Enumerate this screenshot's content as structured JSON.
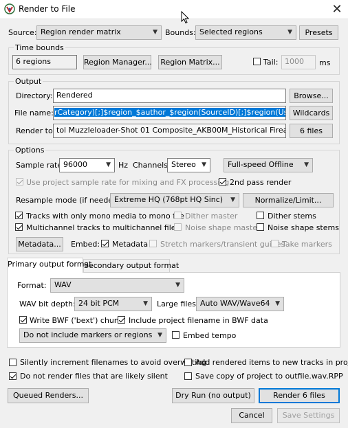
{
  "window": {
    "title": "Render to File"
  },
  "source": {
    "label": "Source:",
    "value": "Region render matrix"
  },
  "bounds": {
    "label": "Bounds:",
    "value": "Selected regions"
  },
  "presets_label": "Presets",
  "time_bounds": {
    "title": "Time bounds",
    "regions_value": "6 regions",
    "region_manager": "Region Manager...",
    "region_matrix": "Region Matrix...",
    "tail_label": "Tail:",
    "tail_checked": false,
    "tail_value": "1000",
    "tail_unit": "ms"
  },
  "output": {
    "title": "Output",
    "directory_label": "Directory:",
    "directory_value": "Rendered",
    "browse": "Browse...",
    "filename_label": "File name:",
    "filename_value": "rCategory)[;]$region_$author_$region(SourceID)[;]$region(UserData)[;]",
    "wildcards": "Wildcards",
    "render_to_label": "Render to:",
    "render_to_value": "tol Muzzleloader-Shot 01 Composite_AKB00M_Historical Firearms.wav",
    "files_count": "6 files"
  },
  "options": {
    "title": "Options",
    "sample_rate_label": "Sample rate:",
    "sample_rate_value": "96000",
    "hz": "Hz",
    "channels_label": "Channels:",
    "channels_value": "Stereo",
    "mode_value": "Full-speed Offline",
    "use_project_rate": "Use project sample rate for mixing and FX processing",
    "second_pass": "2nd pass render",
    "resample_label": "Resample mode (if needed):",
    "resample_value": "Extreme HQ (768pt HQ Sinc)",
    "normalize": "Normalize/Limit...",
    "tracks_mono": "Tracks with only mono media to mono file",
    "dither_master": "Dither master",
    "dither_stems": "Dither stems",
    "multichannel": "Multichannel tracks to multichannel files",
    "noise_master": "Noise shape master",
    "noise_stems": "Noise shape stems",
    "metadata_btn": "Metadata...",
    "embed_label": "Embed:",
    "embed_metadata": "Metadata",
    "stretch_markers": "Stretch markers/transient guides",
    "take_markers": "Take markers"
  },
  "tabs": {
    "primary": "Primary output format",
    "secondary": "Secondary output format"
  },
  "format": {
    "format_label": "Format:",
    "format_value": "WAV",
    "bit_depth_label": "WAV bit depth:",
    "bit_depth_value": "24 bit PCM",
    "large_files_label": "Large files:",
    "large_files_value": "Auto WAV/Wave64",
    "write_bwf": "Write BWF ('bext') chunk",
    "include_filename": "Include project filename in BWF data",
    "markers_value": "Do not include markers or regions",
    "embed_tempo": "Embed tempo"
  },
  "bottom": {
    "silently_increment": "Silently increment filenames to avoid overwriting",
    "add_rendered": "Add rendered items to new tracks in project",
    "do_not_render": "Do not render files that are likely silent",
    "save_copy": "Save copy of project to outfile.wav.RPP",
    "queued": "Queued Renders...",
    "dry_run": "Dry Run (no output)",
    "render": "Render 6 files",
    "cancel": "Cancel",
    "save_settings": "Save Settings"
  }
}
